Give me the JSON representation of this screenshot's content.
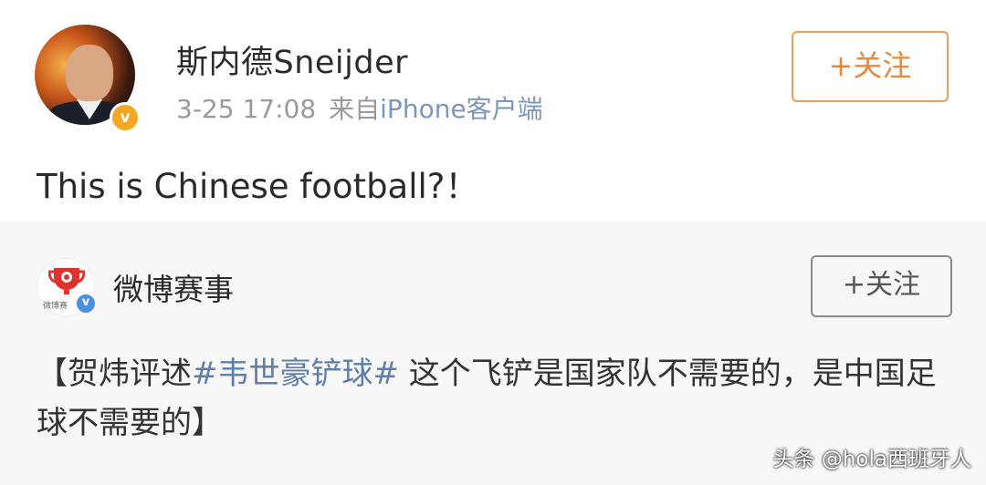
{
  "post": {
    "username": "斯内德Sneijder",
    "time": "3-25 17:08",
    "source_prefix": "来自",
    "source_client": "iPhone客户端",
    "follow_label": "+关注",
    "text": "This is Chinese football?！",
    "verified_badge": "v"
  },
  "repost": {
    "author": "微博赛事",
    "avatar_label": "微博赛",
    "follow_label": "+关注",
    "verified_badge": "v",
    "text_open": "【贺炜评述",
    "hashtag": "#韦世豪铲球#",
    "text_rest": " 这个飞铲是国家队不需要的，是中国足球不需要的】"
  },
  "watermark": "头条 @hola西班牙人",
  "colors": {
    "follow_orange": "#e8883a",
    "link_blue": "#5d7fa8",
    "meta_gray": "#9a9a9a",
    "verified_gold": "#f5a623",
    "verified_blue": "#4a90e2"
  }
}
